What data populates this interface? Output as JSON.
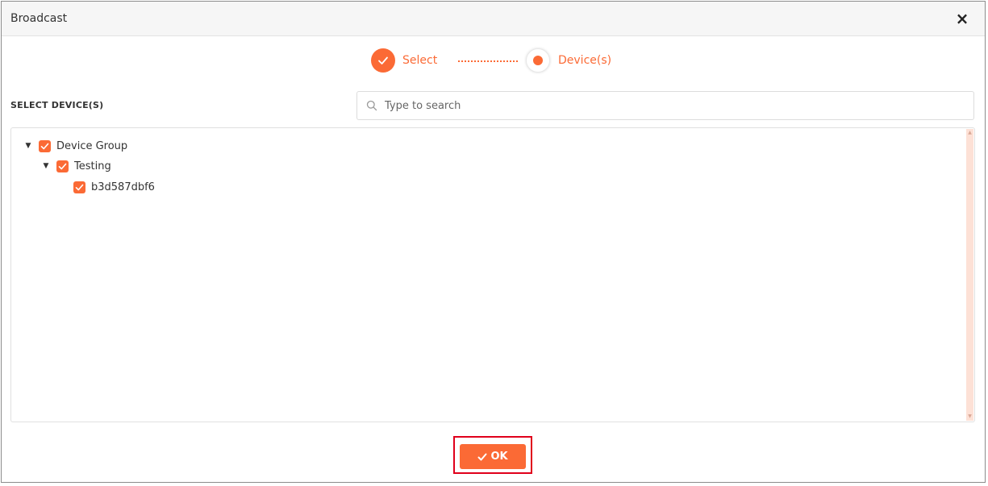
{
  "dialog": {
    "title": "Broadcast",
    "close_label": "×"
  },
  "stepper": {
    "steps": [
      {
        "label": "Select",
        "state": "completed"
      },
      {
        "label": "Device(s)",
        "state": "active"
      }
    ]
  },
  "section": {
    "label": "SELECT DEVICE(S)"
  },
  "search": {
    "placeholder": "Type to search",
    "value": ""
  },
  "tree": {
    "nodes": [
      {
        "label": "Device Group",
        "checked": true,
        "expanded": true,
        "level": 0
      },
      {
        "label": "Testing",
        "checked": true,
        "expanded": true,
        "level": 1
      },
      {
        "label": "b3d587dbf6",
        "checked": true,
        "level": 2
      }
    ]
  },
  "footer": {
    "ok_label": "OK"
  },
  "colors": {
    "accent": "#fb6a35",
    "highlight": "#e0001b",
    "scrollbar_track": "#fde1d6"
  },
  "icons": {
    "close": "close-icon",
    "step_check": "check-icon",
    "search": "search-icon",
    "tree_toggle": "caret-down-icon",
    "checkbox": "checkbox-checked-icon",
    "ok": "check-icon"
  }
}
